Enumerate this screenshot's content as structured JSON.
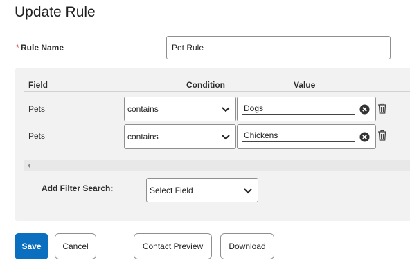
{
  "header": {
    "title": "Update Rule"
  },
  "rule_name": {
    "required_marker": "*",
    "label": "Rule Name",
    "value": "Pet Rule"
  },
  "filters": {
    "columns": {
      "field": "Field",
      "condition": "Condition",
      "value": "Value"
    },
    "rows": [
      {
        "field": "Pets",
        "condition": "contains",
        "value": "Dogs"
      },
      {
        "field": "Pets",
        "condition": "contains",
        "value": "Chickens"
      }
    ],
    "add_filter": {
      "label": "Add Filter Search:",
      "select_value": "Select Field"
    }
  },
  "actions": {
    "save": "Save",
    "cancel": "Cancel",
    "contact_preview": "Contact Preview",
    "download": "Download"
  },
  "colors": {
    "primary": "#0b6fbf",
    "required": "#c23934",
    "panel": "#f2f2f2"
  },
  "icons": [
    "chevron-down-icon",
    "clear-circle-icon",
    "trash-icon",
    "scroll-left-arrow-icon"
  ]
}
